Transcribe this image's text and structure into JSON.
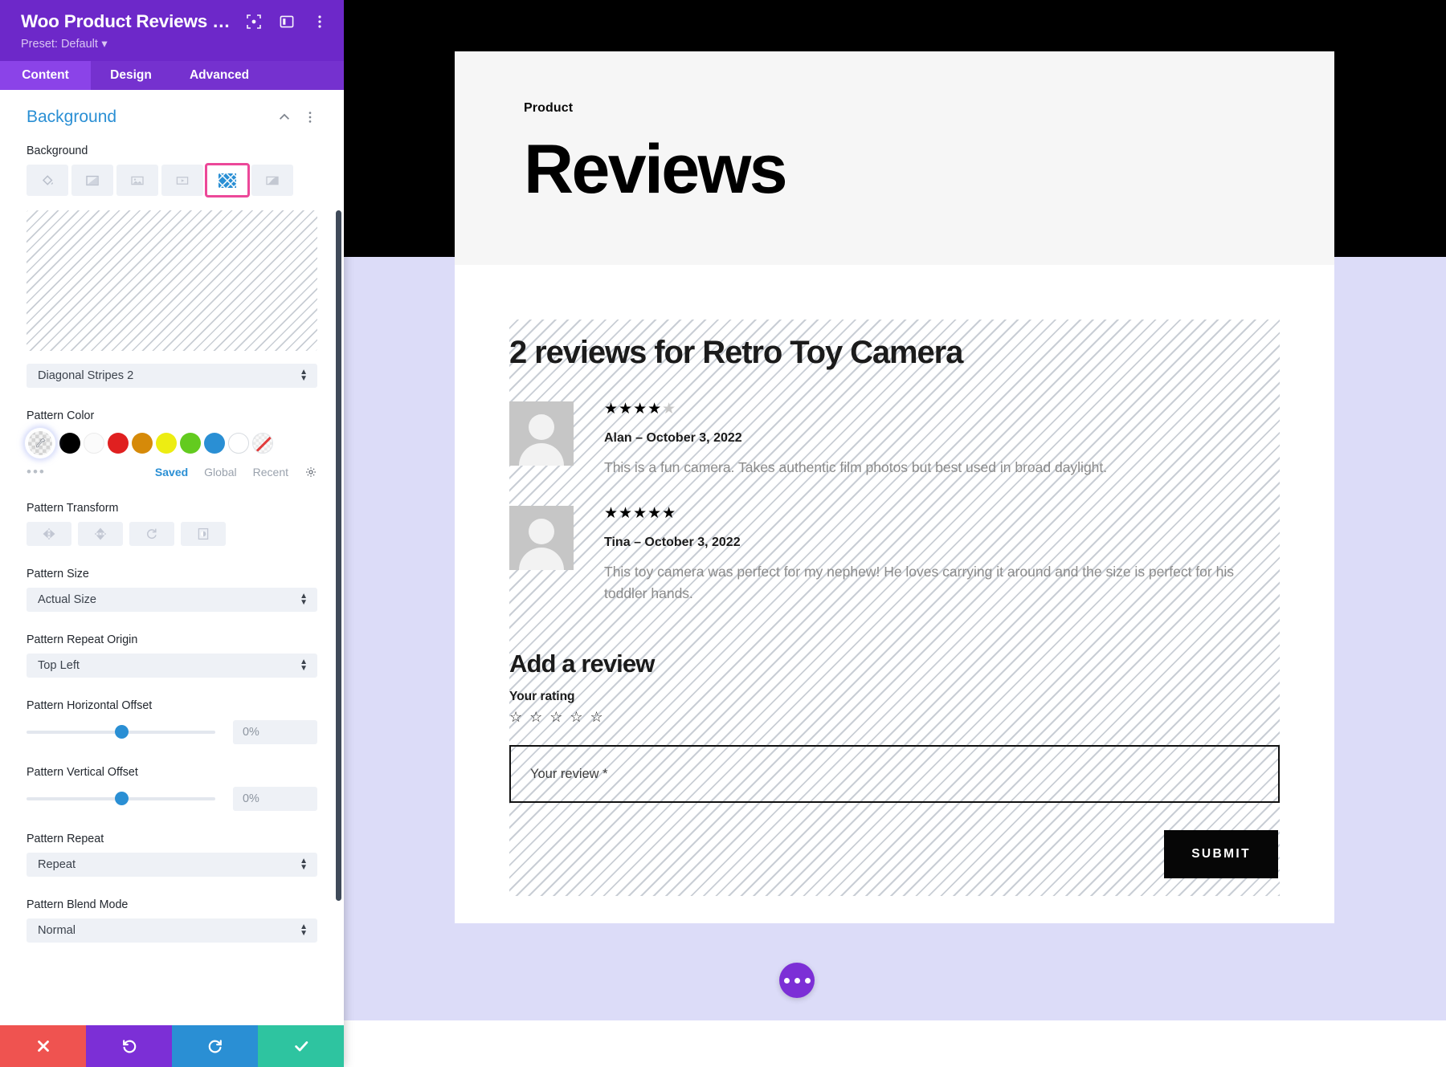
{
  "panel": {
    "title": "Woo Product Reviews Setti…",
    "preset": "Preset: Default",
    "header_icons": [
      "focus-icon",
      "layout-icon",
      "more-vertical-icon"
    ],
    "tabs": [
      {
        "label": "Content",
        "active": true
      },
      {
        "label": "Design",
        "active": false
      },
      {
        "label": "Advanced",
        "active": false
      }
    ],
    "section": {
      "title": "Background",
      "collapse_icon": "chevron-up-icon",
      "menu_icon": "more-vertical-icon"
    },
    "background_field_label": "Background",
    "background_types": [
      {
        "name": "background-color",
        "active": false
      },
      {
        "name": "background-gradient",
        "active": false
      },
      {
        "name": "background-image",
        "active": false
      },
      {
        "name": "background-video",
        "active": false
      },
      {
        "name": "background-pattern",
        "active": true
      },
      {
        "name": "background-mask",
        "active": false
      }
    ],
    "pattern_select": {
      "value": "Diagonal Stripes 2"
    },
    "pattern_color": {
      "label": "Pattern Color",
      "swatches": [
        {
          "name": "color-picker",
          "color": "checker"
        },
        {
          "name": "black",
          "color": "#000000"
        },
        {
          "name": "white",
          "color": "#ffffff"
        },
        {
          "name": "red",
          "color": "#e02020"
        },
        {
          "name": "orange",
          "color": "#d68a09"
        },
        {
          "name": "yellow",
          "color": "#eded12"
        },
        {
          "name": "green",
          "color": "#63cb1f"
        },
        {
          "name": "blue",
          "color": "#2a8fd4"
        },
        {
          "name": "empty",
          "color": "#ffffff"
        },
        {
          "name": "none",
          "color": "transparent"
        }
      ],
      "more_dots": "•••",
      "tabs": [
        {
          "label": "Saved",
          "active": true
        },
        {
          "label": "Global",
          "active": false
        },
        {
          "label": "Recent",
          "active": false
        }
      ],
      "settings_icon": "gear-icon"
    },
    "pattern_transform": {
      "label": "Pattern Transform",
      "buttons": [
        "flip-horizontal-icon",
        "flip-vertical-icon",
        "rotate-icon",
        "invert-icon"
      ]
    },
    "pattern_size": {
      "label": "Pattern Size",
      "value": "Actual Size"
    },
    "pattern_repeat_origin": {
      "label": "Pattern Repeat Origin",
      "value": "Top Left"
    },
    "pattern_horizontal_offset": {
      "label": "Pattern Horizontal Offset",
      "value": "0%",
      "knob_percent": 50
    },
    "pattern_vertical_offset": {
      "label": "Pattern Vertical Offset",
      "value": "0%",
      "knob_percent": 50
    },
    "pattern_repeat": {
      "label": "Pattern Repeat",
      "value": "Repeat"
    },
    "pattern_blend_mode": {
      "label": "Pattern Blend Mode",
      "value": "Normal"
    },
    "bottom_bar": [
      {
        "name": "cancel-button",
        "icon": "close-icon",
        "color": "#ef5350"
      },
      {
        "name": "undo-button",
        "icon": "undo-icon",
        "color": "#7c2fd6"
      },
      {
        "name": "redo-button",
        "icon": "redo-icon",
        "color": "#2a8fd4"
      },
      {
        "name": "save-button",
        "icon": "check-icon",
        "color": "#2ec4a0"
      }
    ]
  },
  "preview": {
    "hero": {
      "kicker": "Product",
      "title": "Reviews"
    },
    "reviews_heading": "2 reviews for Retro Toy Camera",
    "reviews": [
      {
        "author": "Alan",
        "separator": "–",
        "date": "October 3, 2022",
        "rating": 4,
        "max_rating": 5,
        "text": "This is a fun camera. Takes authentic film photos but best used in broad daylight."
      },
      {
        "author": "Tina",
        "separator": "–",
        "date": "October 3, 2022",
        "rating": 5,
        "max_rating": 5,
        "text": "This toy camera was perfect for my nephew! He loves carrying it around and the size is perfect for his toddler hands."
      }
    ],
    "add_review": {
      "heading": "Add a review",
      "rating_label": "Your rating",
      "rating_value": 0,
      "rating_max": 5,
      "review_placeholder": "Your review *",
      "submit_label": "SUBMIT"
    },
    "fab": {
      "name": "page-settings-fab",
      "icon": "ellipsis-icon"
    }
  }
}
